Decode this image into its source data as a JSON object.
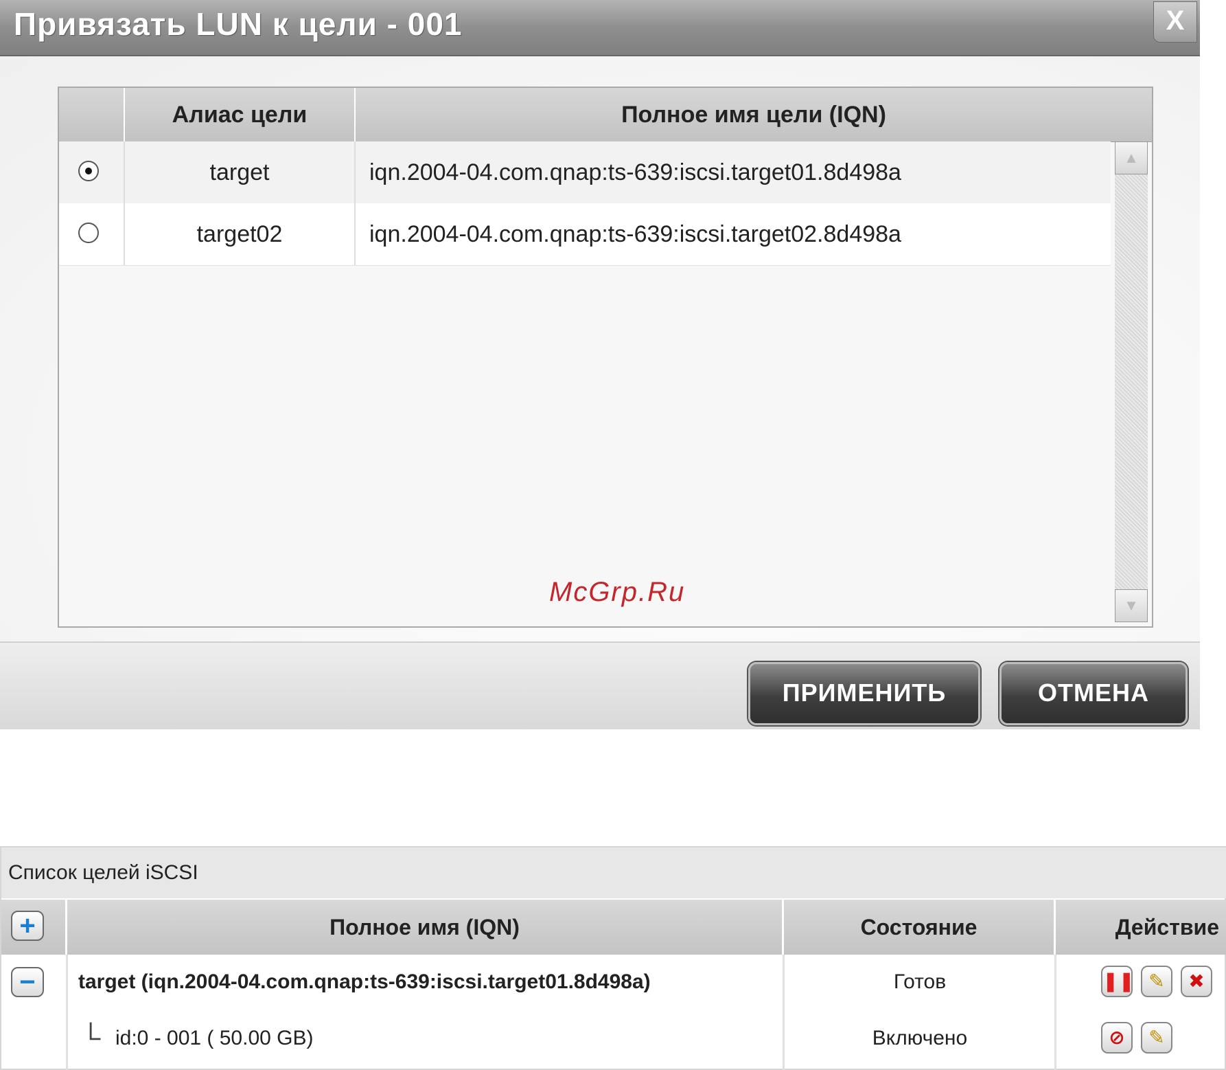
{
  "dialog": {
    "title": "Привязать LUN к цели - 001",
    "close_label": "X",
    "columns": [
      "",
      "Алиас цели",
      "Полное имя цели (IQN)"
    ],
    "rows": [
      {
        "alias": "target",
        "iqn": "iqn.2004-04.com.qnap:ts-639:iscsi.target01.8d498a",
        "selected": true
      },
      {
        "alias": "target02",
        "iqn": "iqn.2004-04.com.qnap:ts-639:iscsi.target02.8d498a",
        "selected": false
      }
    ],
    "watermark": "McGrp.Ru",
    "apply_label": "ПРИМЕНИТЬ",
    "cancel_label": "ОТМЕНА"
  },
  "target_list": {
    "title": "Список целей iSCSI",
    "columns": {
      "add": "+",
      "iqn": "Полное имя (IQN)",
      "status": "Состояние",
      "action": "Действие"
    },
    "target_row": {
      "collapse": "−",
      "name": "target (iqn.2004-04.com.qnap:ts-639:iscsi.target01.8d498a)",
      "status": "Готов"
    },
    "lun_row": {
      "tree_glyph": "└",
      "name": "id:0 - 001 ( 50.00 GB)",
      "status": "Включено"
    },
    "icons": {
      "pause": "pause-icon",
      "edit": "edit-icon",
      "delete": "delete-icon",
      "disable": "disable-icon"
    }
  }
}
